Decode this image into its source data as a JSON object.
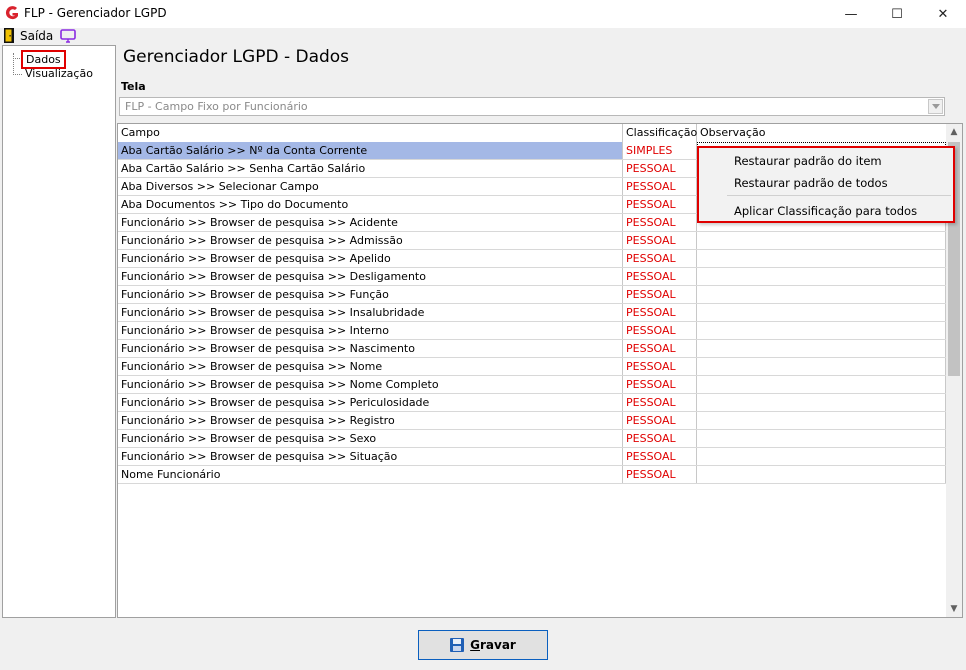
{
  "window": {
    "title": "FLP - Gerenciador LGPD",
    "minimize": "—",
    "maximize": "☐",
    "close": "✕"
  },
  "toolbar": {
    "exit_label": "Saída"
  },
  "tree": {
    "items": [
      {
        "label": "Dados"
      },
      {
        "label": "Visualização"
      }
    ]
  },
  "main": {
    "title": "Gerenciador LGPD - Dados",
    "tela_label": "Tela",
    "tela_value": "FLP - Campo Fixo por Funcionário"
  },
  "grid": {
    "columns": [
      "Campo",
      "Classificação",
      "Observação"
    ],
    "rows": [
      {
        "campo": "Aba Cartão Salário >> Nº da Conta Corrente",
        "classificacao": "SIMPLES",
        "observacao": ""
      },
      {
        "campo": "Aba Cartão Salário >> Senha Cartão Salário",
        "classificacao": "PESSOAL",
        "observacao": ""
      },
      {
        "campo": "Aba Diversos >> Selecionar Campo",
        "classificacao": "PESSOAL",
        "observacao": ""
      },
      {
        "campo": "Aba Documentos >> Tipo do Documento",
        "classificacao": "PESSOAL",
        "observacao": ""
      },
      {
        "campo": "Funcionário >> Browser de pesquisa >> Acidente",
        "classificacao": "PESSOAL",
        "observacao": ""
      },
      {
        "campo": "Funcionário >> Browser de pesquisa >> Admissão",
        "classificacao": "PESSOAL",
        "observacao": ""
      },
      {
        "campo": "Funcionário >> Browser de pesquisa >> Apelido",
        "classificacao": "PESSOAL",
        "observacao": ""
      },
      {
        "campo": "Funcionário >> Browser de pesquisa >> Desligamento",
        "classificacao": "PESSOAL",
        "observacao": ""
      },
      {
        "campo": "Funcionário >> Browser de pesquisa >> Função",
        "classificacao": "PESSOAL",
        "observacao": ""
      },
      {
        "campo": "Funcionário >> Browser de pesquisa >> Insalubridade",
        "classificacao": "PESSOAL",
        "observacao": ""
      },
      {
        "campo": "Funcionário >> Browser de pesquisa >> Interno",
        "classificacao": "PESSOAL",
        "observacao": ""
      },
      {
        "campo": "Funcionário >> Browser de pesquisa >> Nascimento",
        "classificacao": "PESSOAL",
        "observacao": ""
      },
      {
        "campo": "Funcionário >> Browser de pesquisa >> Nome",
        "classificacao": "PESSOAL",
        "observacao": ""
      },
      {
        "campo": "Funcionário >> Browser de pesquisa >> Nome Completo",
        "classificacao": "PESSOAL",
        "observacao": ""
      },
      {
        "campo": "Funcionário >> Browser de pesquisa >> Periculosidade",
        "classificacao": "PESSOAL",
        "observacao": ""
      },
      {
        "campo": "Funcionário >> Browser de pesquisa >> Registro",
        "classificacao": "PESSOAL",
        "observacao": ""
      },
      {
        "campo": "Funcionário >> Browser de pesquisa >> Sexo",
        "classificacao": "PESSOAL",
        "observacao": ""
      },
      {
        "campo": "Funcionário >> Browser de pesquisa >> Situação",
        "classificacao": "PESSOAL",
        "observacao": ""
      },
      {
        "campo": "Nome Funcionário",
        "classificacao": "PESSOAL",
        "observacao": ""
      }
    ]
  },
  "context_menu": {
    "items": [
      {
        "label": "Restaurar padrão do item"
      },
      {
        "label": "Restaurar padrão de todos"
      },
      {
        "label": "Aplicar Classificação para todos"
      }
    ]
  },
  "footer": {
    "save_label": "Gravar"
  },
  "colors": {
    "selected_row": "#a4b8e6",
    "classification_text": "#e00000",
    "highlight_border": "#e00000"
  }
}
